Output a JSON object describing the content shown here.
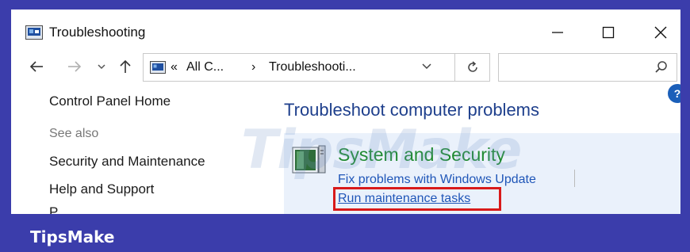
{
  "window": {
    "title": "Troubleshooting",
    "controls": {
      "minimize": "—",
      "maximize": "☐",
      "close": "✕"
    }
  },
  "navbar": {
    "address": {
      "overflow": "«",
      "segments": [
        "All C...",
        "Troubleshooti..."
      ],
      "separator": "›"
    },
    "search": {
      "placeholder": ""
    }
  },
  "left_pane": {
    "home": "Control Panel Home",
    "see_also": "See also",
    "links": [
      "Security and Maintenance",
      "Help and Support"
    ],
    "partial": "P"
  },
  "main": {
    "heading": "Troubleshoot computer problems",
    "category": {
      "title": "System and Security",
      "links": [
        "Fix problems with Windows Update",
        "Run maintenance tasks"
      ]
    }
  },
  "watermark": "TipsMake",
  "brand": "TipsMake",
  "colors": {
    "frame": "#3b3dab",
    "heading": "#1e3f8c",
    "category_title": "#1f8a31",
    "link": "#1f56b8",
    "highlight": "#d81a1a",
    "panel": "#eaf1fb"
  }
}
